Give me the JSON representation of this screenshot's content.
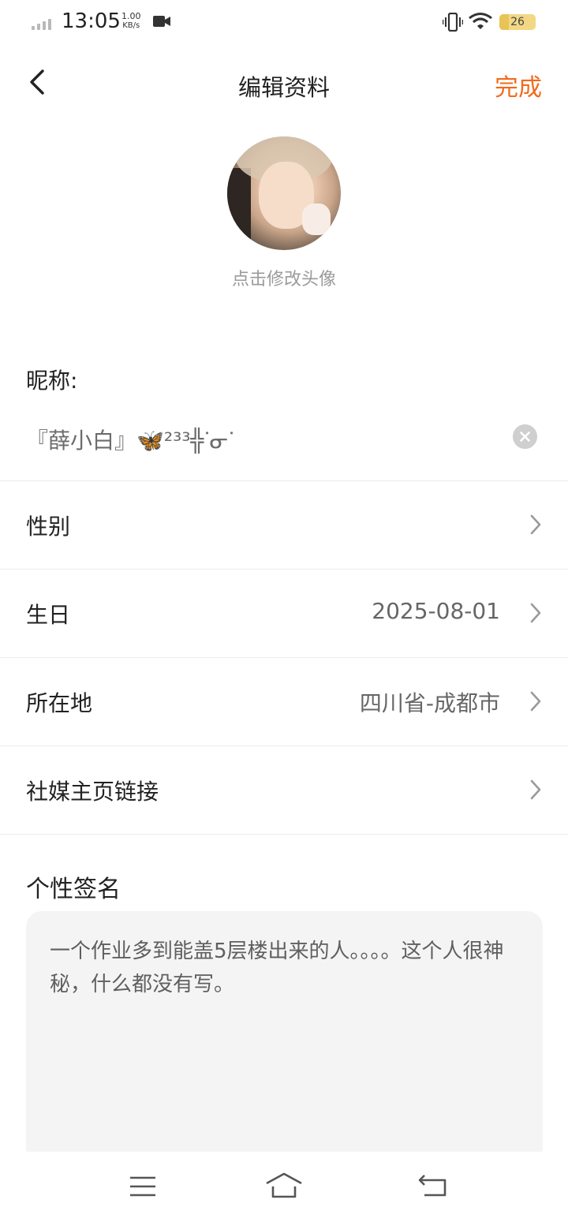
{
  "status_bar": {
    "time": "13:05",
    "speed_value": "1.00",
    "speed_unit": "KB/s",
    "battery": "26",
    "battery_level": 0.26
  },
  "header": {
    "title": "编辑资料",
    "done_label": "完成"
  },
  "avatar": {
    "caption": "点击修改头像"
  },
  "nickname": {
    "label": "昵称:",
    "value": "『薛小白』🦋²³³╬ᐝᓂᐝ"
  },
  "rows": [
    {
      "label": "性别",
      "value": ""
    },
    {
      "label": "生日",
      "value": "2025-08-01"
    },
    {
      "label": "所在地",
      "value": "四川省-成都市"
    },
    {
      "label": "社媒主页链接",
      "value": ""
    }
  ],
  "signature": {
    "label": "个性签名",
    "text": "一个作业多到能盖5层楼出来的人。。。。这个人很神秘，什么都没有写。"
  },
  "colors": {
    "accent": "#f26a1b",
    "battery": "#f2d884"
  }
}
